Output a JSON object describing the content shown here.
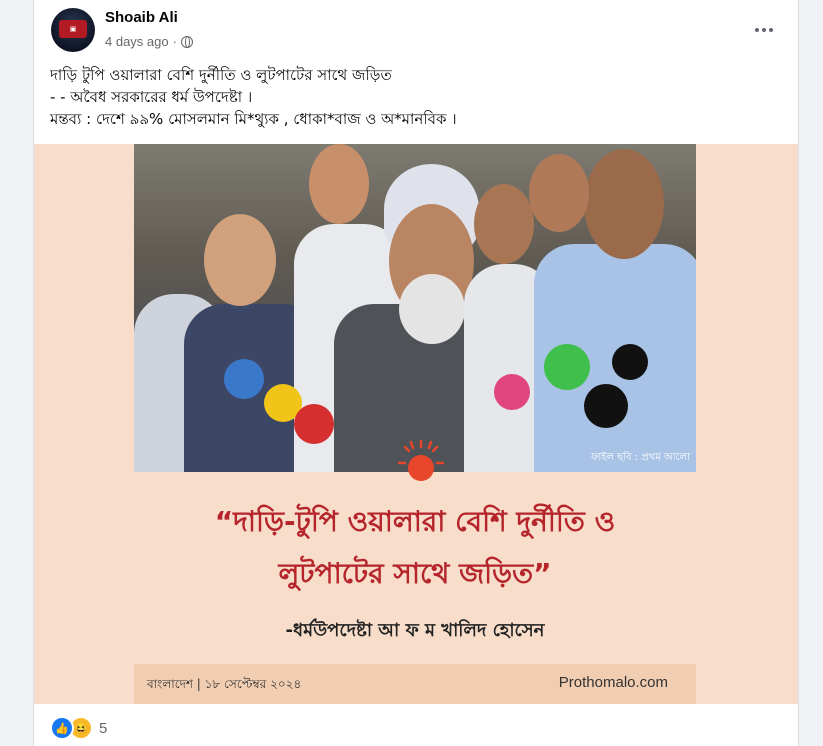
{
  "post": {
    "author": "Shoaib Ali",
    "time": "4 days ago",
    "separator": "·",
    "privacy_icon": "globe-icon",
    "more_icon": "more-horizontal-icon",
    "text_lines": [
      "দাড়ি টুপি ওয়ালারা বেশি দুর্নীতি ও লুটপাটের সাথে জড়িত",
      "- - অবৈধ সরকারের ধর্ম উপদেষ্টা ।",
      "মন্তব্য : দেশে ৯৯% মোসলমান মি*থ্যুক , ধোকা*বাজ ও অ*মানবিক ।"
    ]
  },
  "image_card": {
    "photo_credit": "ফাইল ছবি : প্রথম আলো",
    "quote_lines": [
      "“দাড়ি-টুপি ওয়ালারা বেশি দুর্নীতি ও",
      "লুটপাটের সাথে জড়িত”"
    ],
    "attribution": "-ধর্মউপদেষ্টা আ ফ ম খালিদ হোসেন",
    "footer_left": "বাংলাদেশ | ১৮ সেপ্টেম্বর ২০২৪",
    "footer_right": "Prothomalo.com",
    "colors": {
      "background": "#f7ddca",
      "quote": "#b5252b",
      "sun": "#e8462a",
      "band": "#f1cdb1"
    }
  },
  "reactions": {
    "icons": [
      "like-icon",
      "haha-icon"
    ],
    "count": "5"
  }
}
